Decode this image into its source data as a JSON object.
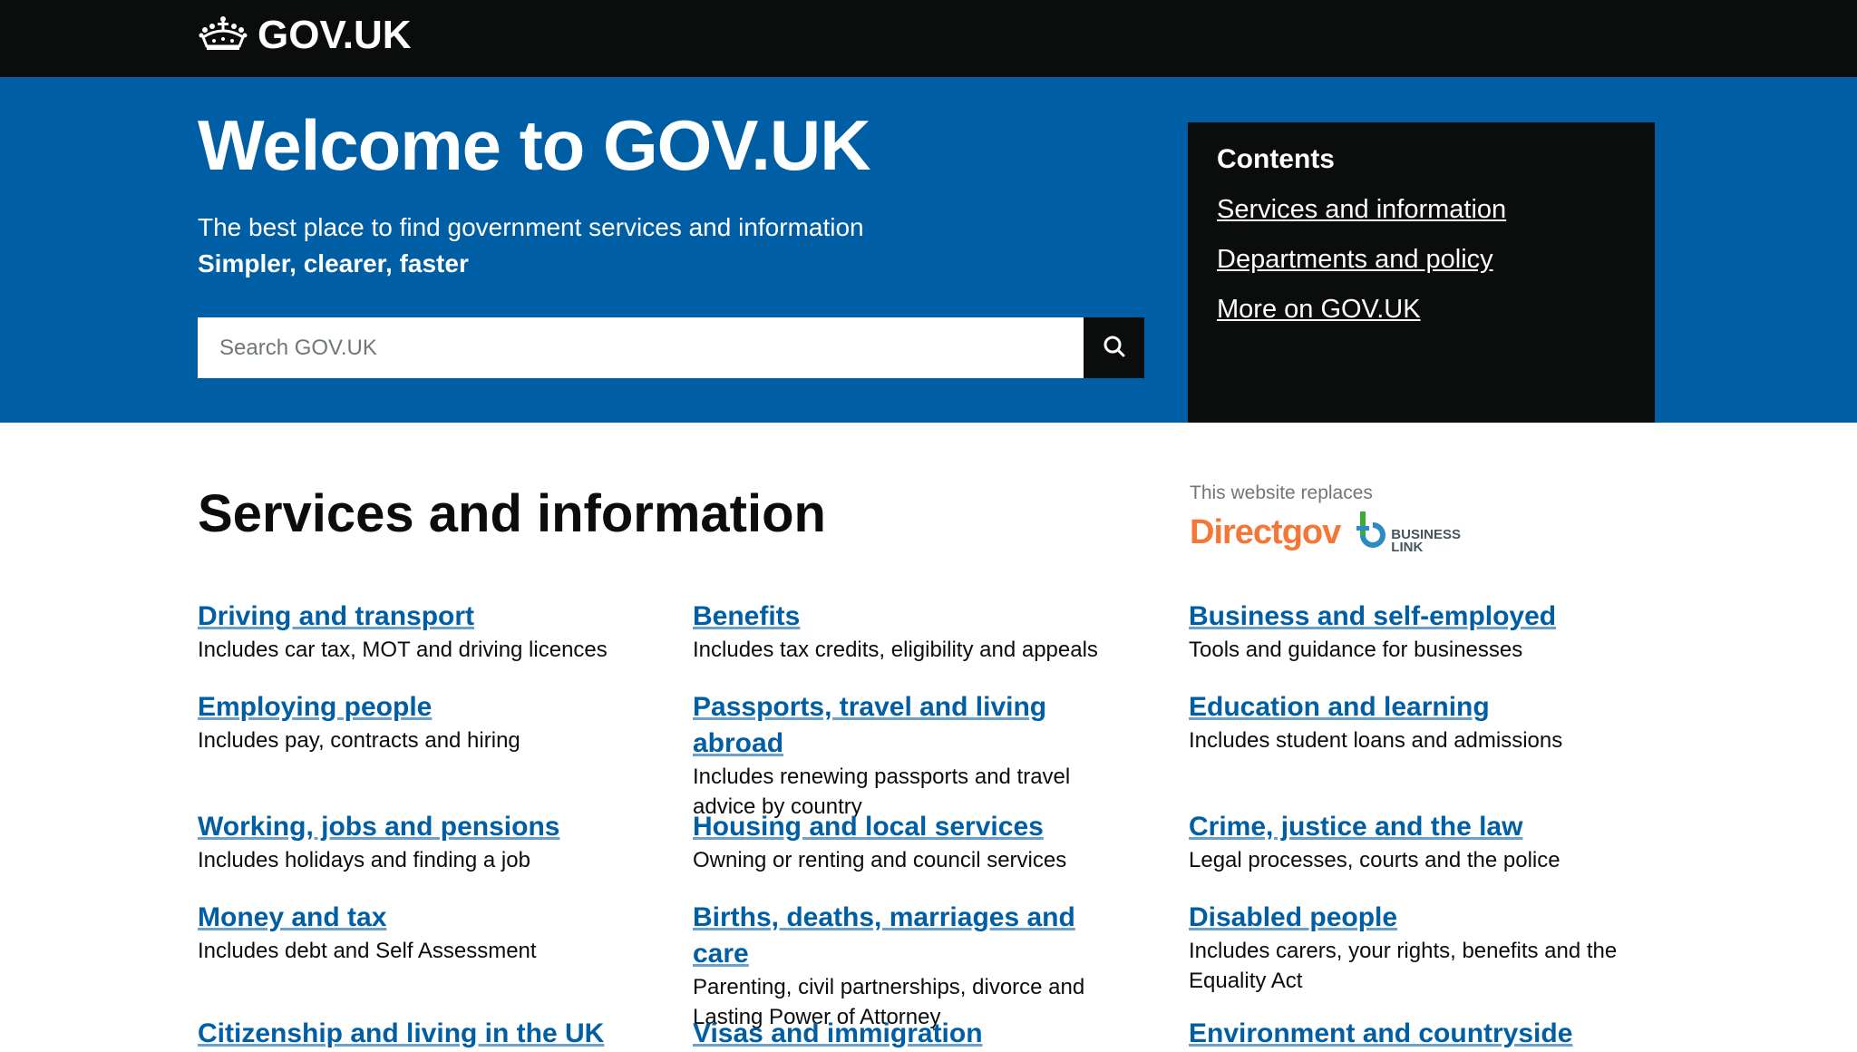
{
  "header": {
    "logo_text": "GOV.UK",
    "logo_icon": "crown-icon"
  },
  "hero": {
    "title": "Welcome to GOV.UK",
    "tagline": "The best place to find government services and information",
    "tagline_bold": "Simpler, clearer, faster",
    "search": {
      "placeholder": "Search GOV.UK",
      "value": "",
      "button_icon": "search-icon"
    }
  },
  "contents": {
    "heading": "Contents",
    "links": [
      "Services and information",
      "Departments and policy",
      "More on GOV.UK"
    ]
  },
  "services": {
    "heading": "Services and information",
    "replaces": {
      "label": "This website replaces",
      "logos": [
        "Directgov",
        "BUSINESS LINK"
      ]
    },
    "items": [
      {
        "title": "Driving and transport",
        "desc": "Includes car tax, MOT and driving licences"
      },
      {
        "title": "Benefits",
        "desc": "Includes tax credits, eligibility and appeals"
      },
      {
        "title": "Business and self-employed",
        "desc": "Tools and guidance for businesses"
      },
      {
        "title": "Employing people",
        "desc": "Includes pay, contracts and hiring"
      },
      {
        "title": "Passports, travel and living abroad",
        "desc": "Includes renewing passports and travel advice by country"
      },
      {
        "title": "Education and learning",
        "desc": "Includes student loans and admissions"
      },
      {
        "title": "Working, jobs and pensions",
        "desc": "Includes holidays and finding a job"
      },
      {
        "title": "Housing and local services",
        "desc": "Owning or renting and council services"
      },
      {
        "title": "Crime, justice and the law",
        "desc": "Legal processes, courts and the police"
      },
      {
        "title": "Money and tax",
        "desc": "Includes debt and Self Assessment"
      },
      {
        "title": "Births, deaths, marriages and care",
        "desc": "Parenting, civil partnerships, divorce and Lasting Power of Attorney"
      },
      {
        "title": "Disabled people",
        "desc": "Includes carers, your rights, benefits and the Equality Act"
      },
      {
        "title": "Citizenship and living in the UK",
        "desc": ""
      },
      {
        "title": "Visas and immigration",
        "desc": ""
      },
      {
        "title": "Environment and countryside",
        "desc": ""
      }
    ]
  },
  "colors": {
    "brand_blue": "#005ea5",
    "header_black": "#0b0c0c",
    "link_blue": "#005ea5",
    "directgov_orange": "#f47738"
  }
}
